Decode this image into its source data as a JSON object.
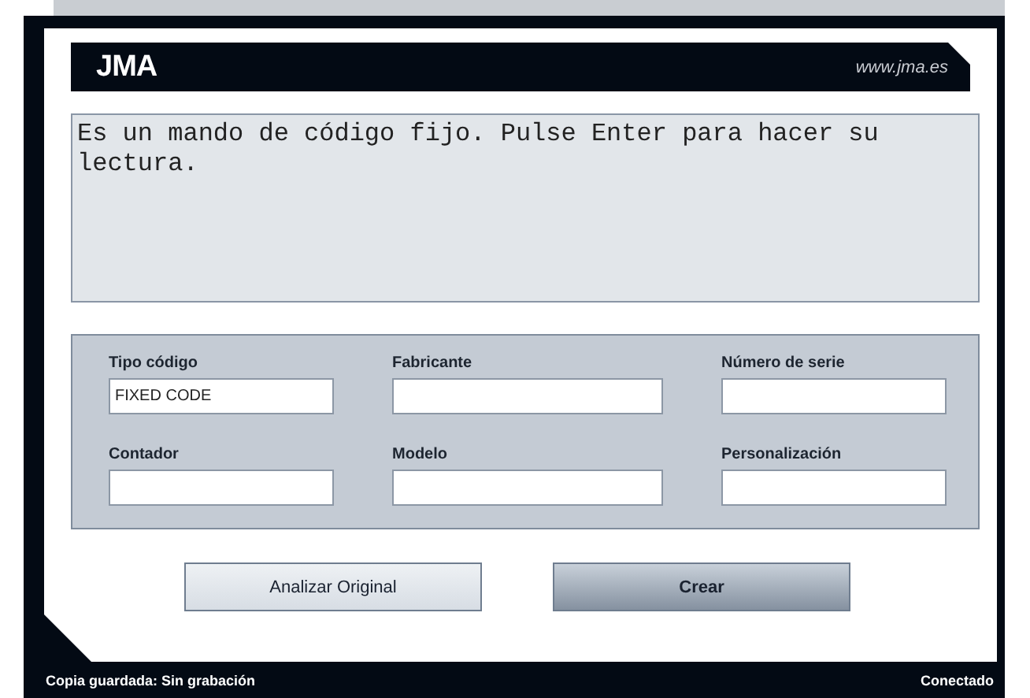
{
  "header": {
    "logo": "JMA",
    "website": "www.jma.es"
  },
  "message": "Es un mando de código fijo. Pulse Enter para hacer su lectura.",
  "fields": [
    {
      "label": "Tipo código",
      "value": "FIXED CODE"
    },
    {
      "label": "Fabricante"
    },
    {
      "label": "Número de serie"
    },
    {
      "label": "Contador"
    },
    {
      "label": "Modelo"
    },
    {
      "label": "Personalización"
    }
  ],
  "buttons": [
    {
      "label": "Analizar Original",
      "kind": "secondary"
    },
    {
      "label": "Crear",
      "kind": "primary"
    }
  ],
  "status_bar": {
    "left": "Copia guardada: Sin grabación",
    "right": "Conectado"
  }
}
